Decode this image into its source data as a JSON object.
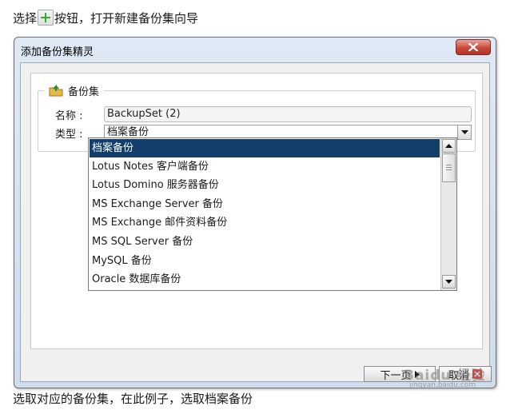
{
  "caption_top": {
    "before": "选择",
    "after": "按钮，打开新建备份集向导"
  },
  "caption_bottom": "选取对应的备份集，在此例子，选取档案备份",
  "dialog": {
    "title": "添加备份集精灵",
    "close_icon": "close-x-icon",
    "group": {
      "title": "备份集",
      "icon": "backup-set-icon"
    },
    "name_label": "名称 :",
    "name_value": "BackupSet (2)",
    "type_label": "类型 :",
    "type_selected": "档案备份",
    "type_options": [
      "档案备份",
      "Lotus Notes 客户端备份",
      "Lotus Domino 服务器备份",
      "MS Exchange Server 备份",
      "MS Exchange 邮件资料备份",
      "MS SQL Server 备份",
      "MySQL 备份",
      "Oracle 数据库备份"
    ],
    "next_button": "下一页",
    "cancel_button": "取消"
  },
  "watermark": {
    "brand": "Baidu 经验",
    "url": "jingyan.baidu.com"
  },
  "colors": {
    "selection": "#123e6b",
    "close_button": "#c9493a",
    "window_frame": "#cfdcec"
  }
}
